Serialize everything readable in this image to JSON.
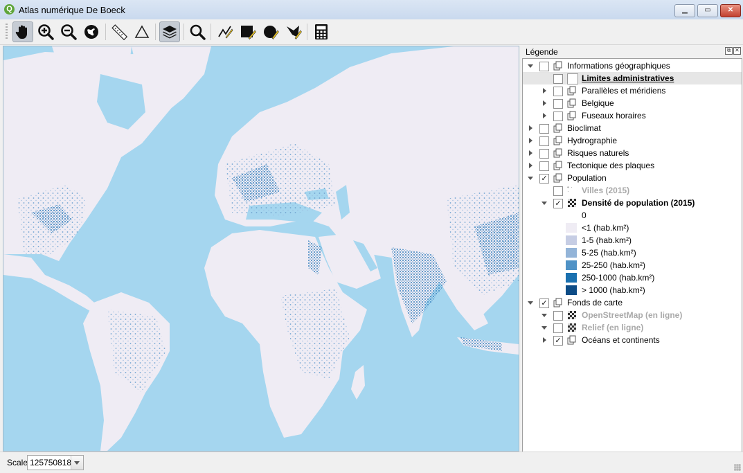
{
  "window": {
    "title": "Atlas numérique De Boeck",
    "app_icon_letter": "Q",
    "controls": [
      "minimize-icon",
      "maximize-icon",
      "close-icon"
    ]
  },
  "toolbar": {
    "tools": [
      {
        "name": "pan-hand-icon",
        "active": true
      },
      {
        "name": "zoom-in-icon"
      },
      {
        "name": "zoom-out-icon"
      },
      {
        "name": "zoom-full-icon"
      },
      {
        "name": "measure-ruler-icon"
      },
      {
        "name": "measure-area-icon"
      },
      {
        "name": "layers-icon",
        "active": true
      },
      {
        "name": "identify-search-icon"
      },
      {
        "name": "edit-line-icon"
      },
      {
        "name": "edit-square-icon"
      },
      {
        "name": "edit-circle-icon"
      },
      {
        "name": "edit-shape-icon"
      },
      {
        "name": "calculator-icon"
      }
    ]
  },
  "legend": {
    "title": "Légende",
    "items": [
      {
        "label": "Informations géographiques",
        "checked": false,
        "expanded": true
      },
      {
        "label": "Limites administratives",
        "checked": false,
        "style": "underline-bold"
      },
      {
        "label": "Parallèles et méridiens",
        "checked": false,
        "expanded": false
      },
      {
        "label": "Belgique",
        "checked": false,
        "expanded": false
      },
      {
        "label": "Fuseaux horaires",
        "checked": false,
        "expanded": false
      },
      {
        "label": "Bioclimat",
        "checked": false,
        "expanded": false
      },
      {
        "label": "Hydrographie",
        "checked": false,
        "expanded": false
      },
      {
        "label": "Risques naturels",
        "checked": false,
        "expanded": false
      },
      {
        "label": "Tectonique des plaques",
        "checked": false,
        "expanded": false
      },
      {
        "label": "Population",
        "checked": true,
        "expanded": true
      },
      {
        "label": "Villes (2015)",
        "checked": false,
        "style": "grey"
      },
      {
        "label": "Densité de population (2015)",
        "checked": true,
        "expanded": true,
        "style": "bold"
      },
      {
        "label": "0"
      },
      {
        "label": "<1  (hab.km²)",
        "color": "#efecf4"
      },
      {
        "label": "1-5 (hab.km²)",
        "color": "#c6cde4"
      },
      {
        "label": "5-25 (hab.km²)",
        "color": "#93b4d8"
      },
      {
        "label": "25-250 (hab.km²)",
        "color": "#4f92c6"
      },
      {
        "label": "250-1000 (hab.km²)",
        "color": "#1a70af"
      },
      {
        "label": "> 1000 (hab.km²)",
        "color": "#0d4c86"
      },
      {
        "label": "Fonds de carte",
        "checked": true,
        "expanded": true
      },
      {
        "label": "OpenStreetMap (en ligne)",
        "checked": false,
        "expanded": true,
        "style": "grey"
      },
      {
        "label": "Relief (en ligne)",
        "checked": false,
        "expanded": true,
        "style": "grey"
      },
      {
        "label": "Océans et continents",
        "checked": true,
        "expanded": false
      }
    ]
  },
  "map": {
    "ocean_color": "#a5d6ef",
    "land_color": "#efecf4"
  },
  "status": {
    "scale_label": "Scale",
    "scale_value": "125750818"
  }
}
